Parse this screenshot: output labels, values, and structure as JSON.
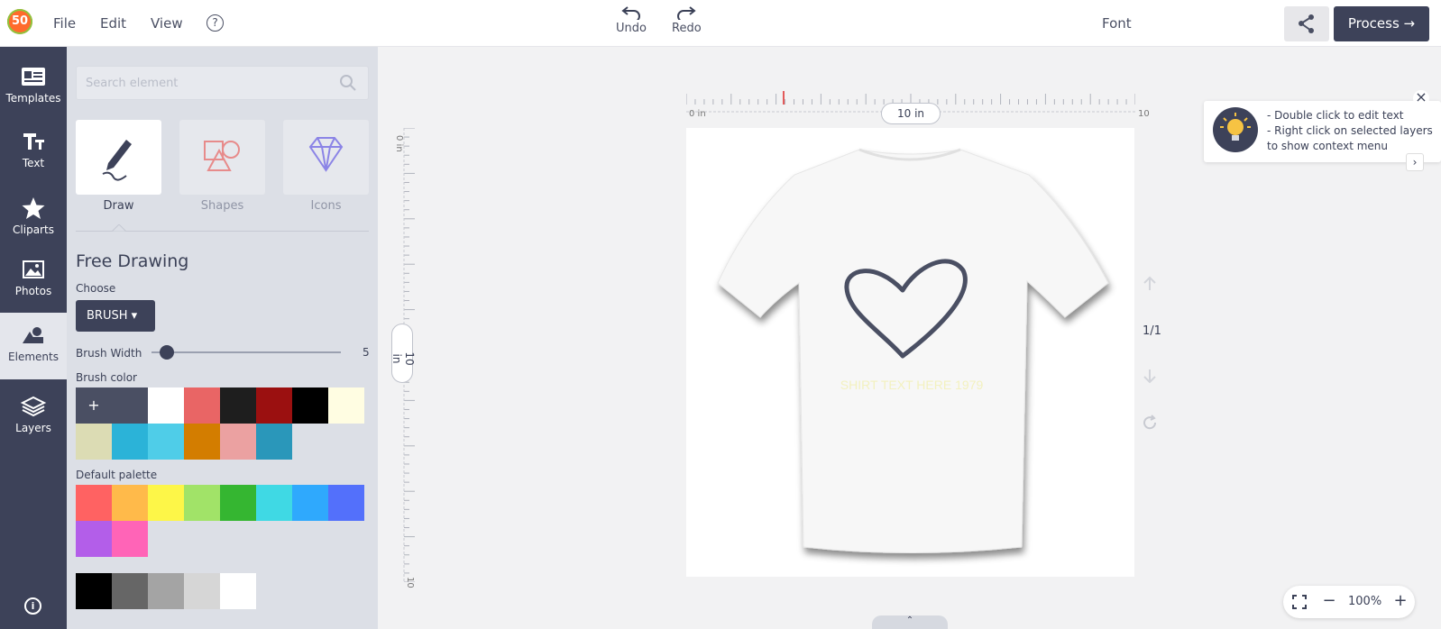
{
  "app": {
    "logo_text": "50"
  },
  "menu": {
    "file": "File",
    "edit": "Edit",
    "view": "View",
    "help": "?"
  },
  "toolbar": {
    "undo": "Undo",
    "redo": "Redo",
    "font": "Font",
    "process": "Process →"
  },
  "leftbar": {
    "items": [
      {
        "label": "Templates",
        "icon": "templates-icon"
      },
      {
        "label": "Text",
        "icon": "text-icon"
      },
      {
        "label": "Cliparts",
        "icon": "star-icon"
      },
      {
        "label": "Photos",
        "icon": "photos-icon"
      },
      {
        "label": "Elements",
        "icon": "elements-icon"
      },
      {
        "label": "Layers",
        "icon": "layers-icon"
      }
    ],
    "info": "i"
  },
  "panel": {
    "search_placeholder": "Search element",
    "tools": [
      {
        "label": "Draw"
      },
      {
        "label": "Shapes"
      },
      {
        "label": "Icons"
      }
    ],
    "heading": "Free Drawing",
    "choose_label": "Choose",
    "brush_label": "BRUSH",
    "brush_width_label": "Brush Width",
    "brush_width_value": "5",
    "brush_width_fraction": 0.05,
    "brush_color_label": "Brush color",
    "default_palette_label": "Default palette",
    "brush_colors": [
      "#4a4f63",
      "#ffffff",
      "#e96565",
      "#1e1e1e",
      "#9b1010",
      "#000000",
      "#fffde2",
      "#dcdcb4",
      "#2bb3d8",
      "#4fcde8",
      "#d37d00",
      "#eba1a1",
      "#2a97ba"
    ],
    "default_palette": [
      "#ff6262",
      "#ffba4a",
      "#fdf648",
      "#a1e368",
      "#35b631",
      "#3fd9e4",
      "#2fa9fd",
      "#5370fb",
      "#b35ee9",
      "#ff64b7"
    ],
    "grays": [
      "#000000",
      "#666666",
      "#a4a4a4",
      "#d6d6d6",
      "#ffffff"
    ]
  },
  "canvas": {
    "h_start": "0 in",
    "h_end": "10",
    "h_dim": "10 in",
    "v_start": "0 in",
    "v_end": "10",
    "v_dim": "10 in",
    "page_count": "1/1",
    "shirt_text": "SHIRT TEXT HERE 1979"
  },
  "tip": {
    "line1": "- Double click to edit text",
    "line2": "- Right click on selected layers to show context menu"
  },
  "zoom": {
    "value": "100%"
  },
  "colors": {
    "accent": "#3d4259",
    "panel": "#dcdfe6"
  }
}
